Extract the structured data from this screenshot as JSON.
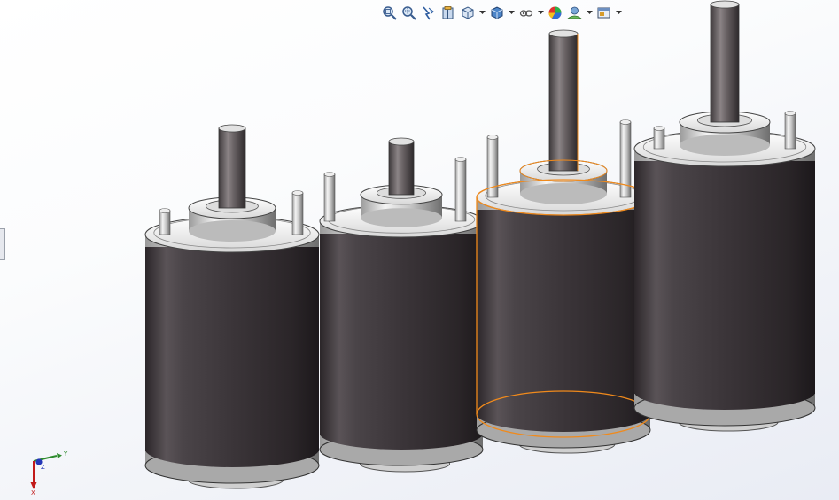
{
  "toolbar": {
    "items": [
      {
        "name": "zoom-to-fit-icon",
        "dropdown": false
      },
      {
        "name": "zoom-to-area-icon",
        "dropdown": false
      },
      {
        "name": "previous-view-icon",
        "dropdown": false
      },
      {
        "name": "section-view-icon",
        "dropdown": false
      },
      {
        "name": "view-orientation-icon",
        "dropdown": true
      },
      {
        "name": "display-style-icon",
        "dropdown": true
      },
      {
        "name": "hide-show-items-icon",
        "dropdown": true
      },
      {
        "name": "edit-appearance-icon",
        "dropdown": false
      },
      {
        "name": "apply-scene-icon",
        "dropdown": true
      },
      {
        "name": "view-settings-icon",
        "dropdown": true
      }
    ]
  },
  "triad": {
    "y_label": "Y",
    "z_label": "Z",
    "x_label": "X"
  },
  "colors": {
    "motor_body": "#3b3539",
    "selection_highlight": "#f08a1c",
    "axis_y": "#2e8b2e",
    "axis_x": "#c21a1a",
    "axis_z": "#2437b8"
  },
  "motors": [
    {
      "name": "motor-1",
      "selected": false
    },
    {
      "name": "motor-2",
      "selected": false
    },
    {
      "name": "motor-3",
      "selected": true
    },
    {
      "name": "motor-4",
      "selected": false
    }
  ]
}
